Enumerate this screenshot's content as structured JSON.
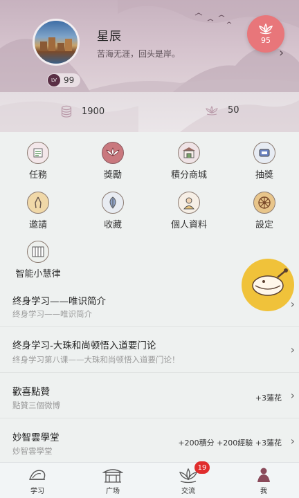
{
  "profile": {
    "username": "星辰",
    "motto": "苦海无涯，回头是岸。",
    "level_prefix": "LV",
    "level": "99",
    "lotus_count": "95"
  },
  "stats": {
    "coins": "1900",
    "lotus": "50"
  },
  "grid": [
    {
      "label": "任務",
      "icon": "task-scroll-icon"
    },
    {
      "label": "獎勵",
      "icon": "reward-lotus-icon"
    },
    {
      "label": "積分商城",
      "icon": "points-mall-icon"
    },
    {
      "label": "抽獎",
      "icon": "lottery-icon"
    },
    {
      "label": "邀請",
      "icon": "invite-hands-icon"
    },
    {
      "label": "收藏",
      "icon": "favorite-leaf-icon"
    },
    {
      "label": "個人資料",
      "icon": "profile-monk-icon"
    },
    {
      "label": "設定",
      "icon": "settings-wheel-icon"
    },
    {
      "label": "智能小慧律",
      "icon": "smart-assistant-icon"
    }
  ],
  "list": [
    {
      "title": "终身学习——唯识简介",
      "subtitle": "终身学习——唯识简介",
      "reward": ""
    },
    {
      "title": "终身学习-大珠和尚顿悟入道要门论",
      "subtitle": "终身学习第八课——大珠和尚顿悟入道要门论！",
      "reward": ""
    },
    {
      "title": "歡喜點贊",
      "subtitle": "點贊三個微博",
      "reward": "+3蓮花"
    },
    {
      "title": "妙智雲學堂",
      "subtitle": "妙智雲學堂",
      "reward": "+200積分 +200經驗 +3蓮花"
    }
  ],
  "nav": [
    {
      "label": "学习",
      "icon": "conch-icon"
    },
    {
      "label": "广场",
      "icon": "temple-icon"
    },
    {
      "label": "交流",
      "icon": "lotus-icon"
    },
    {
      "label": "我",
      "icon": "buddha-icon"
    }
  ],
  "nav_badge": "19",
  "colors": {
    "accent": "#e8767a",
    "header_bg": "#c7b2bf",
    "badge_red": "#e02d2d",
    "float_yellow": "#f0c23a"
  }
}
